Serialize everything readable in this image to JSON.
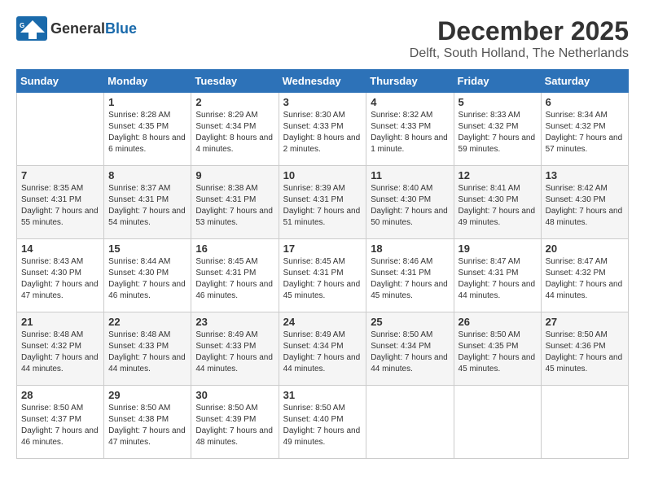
{
  "header": {
    "logo_general": "General",
    "logo_blue": "Blue",
    "month": "December 2025",
    "location": "Delft, South Holland, The Netherlands"
  },
  "days_of_week": [
    "Sunday",
    "Monday",
    "Tuesday",
    "Wednesday",
    "Thursday",
    "Friday",
    "Saturday"
  ],
  "weeks": [
    [
      {
        "day": "",
        "sunrise": "",
        "sunset": "",
        "daylight": "",
        "empty": true
      },
      {
        "day": "1",
        "sunrise": "Sunrise: 8:28 AM",
        "sunset": "Sunset: 4:35 PM",
        "daylight": "Daylight: 8 hours and 6 minutes."
      },
      {
        "day": "2",
        "sunrise": "Sunrise: 8:29 AM",
        "sunset": "Sunset: 4:34 PM",
        "daylight": "Daylight: 8 hours and 4 minutes."
      },
      {
        "day": "3",
        "sunrise": "Sunrise: 8:30 AM",
        "sunset": "Sunset: 4:33 PM",
        "daylight": "Daylight: 8 hours and 2 minutes."
      },
      {
        "day": "4",
        "sunrise": "Sunrise: 8:32 AM",
        "sunset": "Sunset: 4:33 PM",
        "daylight": "Daylight: 8 hours and 1 minute."
      },
      {
        "day": "5",
        "sunrise": "Sunrise: 8:33 AM",
        "sunset": "Sunset: 4:32 PM",
        "daylight": "Daylight: 7 hours and 59 minutes."
      },
      {
        "day": "6",
        "sunrise": "Sunrise: 8:34 AM",
        "sunset": "Sunset: 4:32 PM",
        "daylight": "Daylight: 7 hours and 57 minutes."
      }
    ],
    [
      {
        "day": "7",
        "sunrise": "Sunrise: 8:35 AM",
        "sunset": "Sunset: 4:31 PM",
        "daylight": "Daylight: 7 hours and 55 minutes."
      },
      {
        "day": "8",
        "sunrise": "Sunrise: 8:37 AM",
        "sunset": "Sunset: 4:31 PM",
        "daylight": "Daylight: 7 hours and 54 minutes."
      },
      {
        "day": "9",
        "sunrise": "Sunrise: 8:38 AM",
        "sunset": "Sunset: 4:31 PM",
        "daylight": "Daylight: 7 hours and 53 minutes."
      },
      {
        "day": "10",
        "sunrise": "Sunrise: 8:39 AM",
        "sunset": "Sunset: 4:31 PM",
        "daylight": "Daylight: 7 hours and 51 minutes."
      },
      {
        "day": "11",
        "sunrise": "Sunrise: 8:40 AM",
        "sunset": "Sunset: 4:30 PM",
        "daylight": "Daylight: 7 hours and 50 minutes."
      },
      {
        "day": "12",
        "sunrise": "Sunrise: 8:41 AM",
        "sunset": "Sunset: 4:30 PM",
        "daylight": "Daylight: 7 hours and 49 minutes."
      },
      {
        "day": "13",
        "sunrise": "Sunrise: 8:42 AM",
        "sunset": "Sunset: 4:30 PM",
        "daylight": "Daylight: 7 hours and 48 minutes."
      }
    ],
    [
      {
        "day": "14",
        "sunrise": "Sunrise: 8:43 AM",
        "sunset": "Sunset: 4:30 PM",
        "daylight": "Daylight: 7 hours and 47 minutes."
      },
      {
        "day": "15",
        "sunrise": "Sunrise: 8:44 AM",
        "sunset": "Sunset: 4:30 PM",
        "daylight": "Daylight: 7 hours and 46 minutes."
      },
      {
        "day": "16",
        "sunrise": "Sunrise: 8:45 AM",
        "sunset": "Sunset: 4:31 PM",
        "daylight": "Daylight: 7 hours and 46 minutes."
      },
      {
        "day": "17",
        "sunrise": "Sunrise: 8:45 AM",
        "sunset": "Sunset: 4:31 PM",
        "daylight": "Daylight: 7 hours and 45 minutes."
      },
      {
        "day": "18",
        "sunrise": "Sunrise: 8:46 AM",
        "sunset": "Sunset: 4:31 PM",
        "daylight": "Daylight: 7 hours and 45 minutes."
      },
      {
        "day": "19",
        "sunrise": "Sunrise: 8:47 AM",
        "sunset": "Sunset: 4:31 PM",
        "daylight": "Daylight: 7 hours and 44 minutes."
      },
      {
        "day": "20",
        "sunrise": "Sunrise: 8:47 AM",
        "sunset": "Sunset: 4:32 PM",
        "daylight": "Daylight: 7 hours and 44 minutes."
      }
    ],
    [
      {
        "day": "21",
        "sunrise": "Sunrise: 8:48 AM",
        "sunset": "Sunset: 4:32 PM",
        "daylight": "Daylight: 7 hours and 44 minutes."
      },
      {
        "day": "22",
        "sunrise": "Sunrise: 8:48 AM",
        "sunset": "Sunset: 4:33 PM",
        "daylight": "Daylight: 7 hours and 44 minutes."
      },
      {
        "day": "23",
        "sunrise": "Sunrise: 8:49 AM",
        "sunset": "Sunset: 4:33 PM",
        "daylight": "Daylight: 7 hours and 44 minutes."
      },
      {
        "day": "24",
        "sunrise": "Sunrise: 8:49 AM",
        "sunset": "Sunset: 4:34 PM",
        "daylight": "Daylight: 7 hours and 44 minutes."
      },
      {
        "day": "25",
        "sunrise": "Sunrise: 8:50 AM",
        "sunset": "Sunset: 4:34 PM",
        "daylight": "Daylight: 7 hours and 44 minutes."
      },
      {
        "day": "26",
        "sunrise": "Sunrise: 8:50 AM",
        "sunset": "Sunset: 4:35 PM",
        "daylight": "Daylight: 7 hours and 45 minutes."
      },
      {
        "day": "27",
        "sunrise": "Sunrise: 8:50 AM",
        "sunset": "Sunset: 4:36 PM",
        "daylight": "Daylight: 7 hours and 45 minutes."
      }
    ],
    [
      {
        "day": "28",
        "sunrise": "Sunrise: 8:50 AM",
        "sunset": "Sunset: 4:37 PM",
        "daylight": "Daylight: 7 hours and 46 minutes."
      },
      {
        "day": "29",
        "sunrise": "Sunrise: 8:50 AM",
        "sunset": "Sunset: 4:38 PM",
        "daylight": "Daylight: 7 hours and 47 minutes."
      },
      {
        "day": "30",
        "sunrise": "Sunrise: 8:50 AM",
        "sunset": "Sunset: 4:39 PM",
        "daylight": "Daylight: 7 hours and 48 minutes."
      },
      {
        "day": "31",
        "sunrise": "Sunrise: 8:50 AM",
        "sunset": "Sunset: 4:40 PM",
        "daylight": "Daylight: 7 hours and 49 minutes."
      },
      {
        "day": "",
        "sunrise": "",
        "sunset": "",
        "daylight": "",
        "empty": true
      },
      {
        "day": "",
        "sunrise": "",
        "sunset": "",
        "daylight": "",
        "empty": true
      },
      {
        "day": "",
        "sunrise": "",
        "sunset": "",
        "daylight": "",
        "empty": true
      }
    ]
  ]
}
